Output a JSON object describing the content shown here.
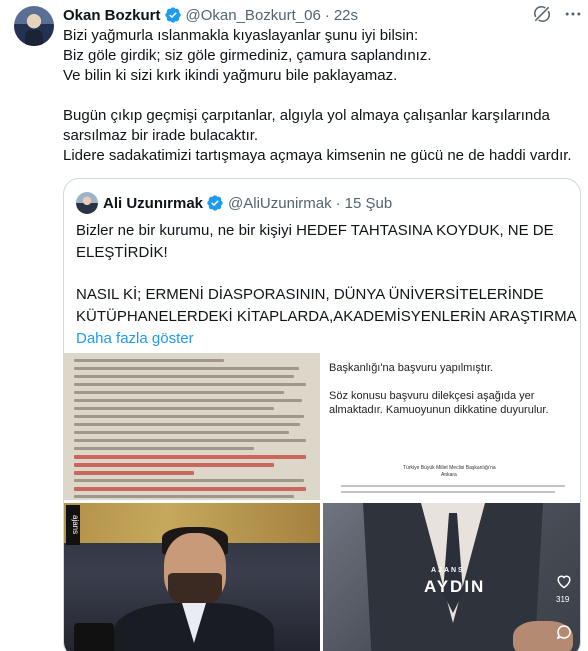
{
  "tweet": {
    "author_name": "Okan Bozkurt",
    "author_handle": "@Okan_Bozkurt_06",
    "separator": "·",
    "time": "22s",
    "lines": [
      "Bizi yağmurla ıslanmakla kıyaslayanlar şunu iyi bilsin:",
      "Biz göle girdik; siz göle girmediniz, çamura saplandınız.",
      "Ve bilin ki sizi kırk ikindi yağmuru bile paklayamaz.",
      "",
      "Bugün çıkıp geçmişi çarpıtanlar, algıyla yol almaya çalışanlar karşılarında",
      "sarsılmaz bir irade bulacaktır.",
      "Lidere sadakatimizi tartışmaya açmaya kimsenin ne gücü ne de haddi vardır."
    ]
  },
  "quote": {
    "author_name": "Ali Uzunırmak",
    "author_handle": "@AliUzunirmak",
    "separator": "·",
    "date": "15 Şub",
    "lines": [
      "Bizler ne bir kurumu, ne bir kişiyi HEDEF TAHTASINA KOYDUK, NE DE",
      "ELEŞTİRDİK!",
      "",
      "NASIL Kİ; ERMENİ DİASPORASININ, DÜNYA ÜNİVERSİTELERİNDE",
      "KÜTÜPHANELERDEKİ KİTAPLARDA,AKADEMİSYENLERİN ARAŞTIRMA ..."
    ],
    "show_more": "Daha fazla göster"
  },
  "media": {
    "page_lines": [
      "Başkanlığı'na başvuru yapılmıştır.",
      "",
      "Söz konusu başvuru dilekçesi aşağıda yer",
      "almaktadır. Kamuoyunun dikkatine duyurulur."
    ],
    "page_small_1": "Türkiye Büyük Millet Meclisi Başkanlığı'na",
    "page_small_2": "Ankara",
    "man_brand": "ajans",
    "suit_brand_small": "AJANS",
    "suit_brand_big": "AYDIN",
    "suit_likes": "319"
  },
  "colors": {
    "verified_blue": "#1d9bf0",
    "link_blue": "#1d9bf0",
    "secondary_text": "#536471",
    "border": "#cfd9de"
  },
  "icons": [
    "verified-badge-icon",
    "grok-icon",
    "more-icon",
    "heart-icon",
    "comment-icon"
  ]
}
